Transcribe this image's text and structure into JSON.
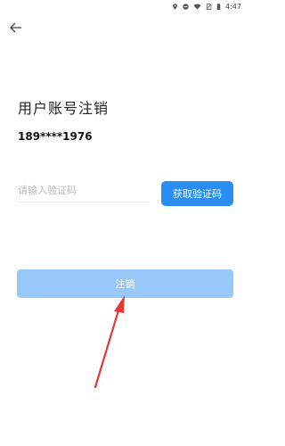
{
  "status_bar": {
    "time": "4:47",
    "icons": [
      "location-icon",
      "do-not-disturb-icon",
      "wifi-icon",
      "no-sim-icon",
      "battery-icon"
    ]
  },
  "nav": {
    "back_icon": "back-arrow-icon"
  },
  "page": {
    "title": "用户账号注销",
    "phone": "189****1976"
  },
  "form": {
    "code_placeholder": "请输入验证码",
    "get_code_label": "获取验证码",
    "submit_label": "注销"
  },
  "colors": {
    "primary": "#2b8ef5",
    "submit_disabled": "#96c8fa",
    "annotation": "#e53935"
  }
}
